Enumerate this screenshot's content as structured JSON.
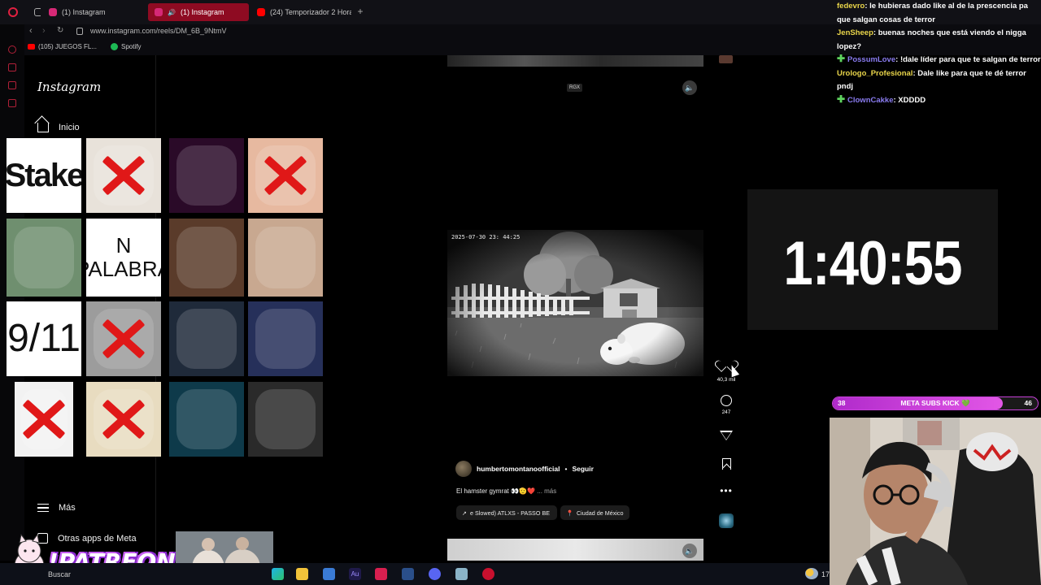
{
  "browser": {
    "tabs": [
      {
        "label": "(1) Instagram",
        "active": false,
        "color": "#d62976"
      },
      {
        "label": "(1) Instagram",
        "active": true,
        "color": "#d62976"
      },
      {
        "label": "(24) Temporizador 2 Hora",
        "active": false,
        "color": "#ff0000"
      }
    ],
    "url": "www.instagram.com/reels/DM_6B_9NtmV",
    "bookmarks": [
      {
        "label": "(105) JUEGOS FL...",
        "icon": "youtube-icon",
        "color": "#ff0000"
      },
      {
        "label": "Spotify",
        "icon": "spotify-icon",
        "color": "#1db954"
      }
    ],
    "accent": "#8e0b22"
  },
  "instagram": {
    "logo": "Instagram",
    "nav": {
      "home": "Inicio",
      "more": "Más",
      "meta_apps": "Otras apps de Meta"
    },
    "reel": {
      "badge": "RGX",
      "camera_timestamp": "2025-07-30   23: 44:25",
      "poster": "humbertomontanoofficial",
      "separator": "•",
      "follow": "Seguir",
      "caption": "El hamster gymrat 👀🫡❤️",
      "caption_more": "... más",
      "audio_chip": "e Slowed)  ATLXS - PASSO BE",
      "location_chip": "Ciudad de México",
      "likes": "40,3 mil",
      "comments": "247"
    }
  },
  "soundboard": [
    {
      "label": "Stake",
      "bg": "#ffffff",
      "crossed": false
    },
    {
      "label": "",
      "bg": "#e8e2da",
      "crossed": true
    },
    {
      "label": "",
      "bg": "#2a0a28",
      "crossed": false
    },
    {
      "label": "",
      "bg": "#e7b9a0",
      "crossed": true
    },
    {
      "label": "",
      "bg": "#6f8f6f",
      "crossed": false
    },
    {
      "label": "N\nPALABRA",
      "bg": "#ffffff",
      "crossed": false
    },
    {
      "label": "",
      "bg": "#5a3b2a",
      "crossed": false
    },
    {
      "label": "",
      "bg": "#c8a890",
      "crossed": false
    },
    {
      "label": "9/11",
      "bg": "#ffffff",
      "crossed": false
    },
    {
      "label": "",
      "bg": "#9c9c9c",
      "crossed": true
    },
    {
      "label": "",
      "bg": "#1f2a3a",
      "crossed": false
    },
    {
      "label": "",
      "bg": "#26305a",
      "crossed": false
    },
    {
      "label": "",
      "bg": "#f2f2f2",
      "crossed": true
    },
    {
      "label": "",
      "bg": "#e8dcc0",
      "crossed": true
    },
    {
      "label": "",
      "bg": "#0e3a4a",
      "crossed": false
    },
    {
      "label": "",
      "bg": "#2a2a2a",
      "crossed": false
    }
  ],
  "chat": [
    {
      "user": "fedevro",
      "color": "#e9d54a",
      "badge": false,
      "text": ": le hubieras dado like al de la prescencia pa que salgan cosas de terror"
    },
    {
      "user": "JenSheep",
      "color": "#e9d54a",
      "badge": false,
      "text": ": buenas noches que está viendo el nigga lopez?"
    },
    {
      "user": "PossumLove",
      "color": "#8a7cf0",
      "badge": true,
      "text": ": !dale líder para que te salgan de terror"
    },
    {
      "user": "Urologo_Profesional",
      "color": "#e9d54a",
      "badge": false,
      "text": ": Dale like para que te dé terror pndj"
    },
    {
      "user": "ClownCakke",
      "color": "#8a7cf0",
      "badge": true,
      "text": ": XDDDD"
    }
  ],
  "timer": "1:40:55",
  "goal": {
    "label": "META SUBS KICK 💚",
    "current": "38",
    "target": "46",
    "progress": 0.83,
    "color": "#c640d8"
  },
  "overlay": {
    "patreon": "!PATREON"
  },
  "taskbar": {
    "search": "Buscar",
    "apps": [
      "edge-icon",
      "folder-icon",
      "store-icon",
      "audition-icon",
      "media-icon",
      "vscode-icon",
      "discord-icon",
      "app-icon",
      "opera-icon"
    ],
    "weather_temp": "17"
  }
}
